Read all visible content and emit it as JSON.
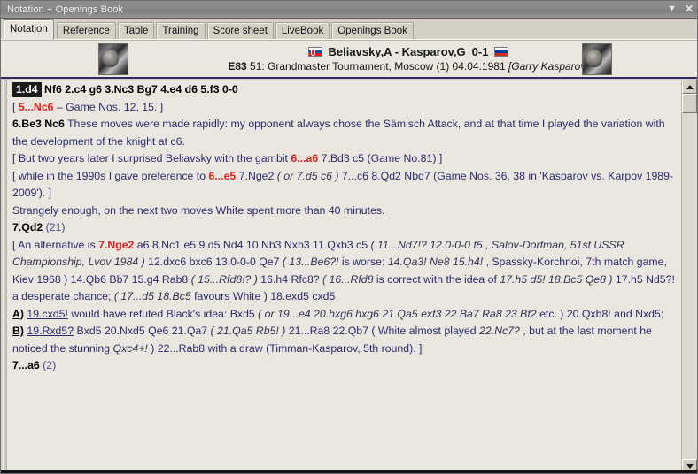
{
  "window": {
    "title": "Notation + Openings Book",
    "minimize_icon": "chevron-down-icon",
    "close_icon": "close-icon",
    "close_glyph": "✕",
    "minimize_glyph": "▼"
  },
  "tabs": [
    {
      "label": "Notation",
      "active": true
    },
    {
      "label": "Reference",
      "active": false
    },
    {
      "label": "Table",
      "active": false
    },
    {
      "label": "Training",
      "active": false
    },
    {
      "label": "Score sheet",
      "active": false
    },
    {
      "label": "LiveBook",
      "active": false
    },
    {
      "label": "Openings Book",
      "active": false
    }
  ],
  "game_header": {
    "white_flag": "slovakia-flag",
    "black_flag": "russia-flag",
    "pairing": "Beliavsky,A - Kasparov,G",
    "result": "0-1",
    "eco": "E83",
    "event": "51: Grandmaster Tournament, Moscow (1) 04.04.1981",
    "annotator": "[Garry Kasparov]",
    "white_photo": "white-player-photo",
    "black_photo": "black-player-photo"
  },
  "notation": {
    "line1": {
      "selected_move": "1.d4",
      "rest": "Nf6  2.c4  g6  3.Nc3  Bg7  4.e4  d6  5.f3  0-0"
    },
    "line2": {
      "open": "[ ",
      "red": "5...Nc6",
      "text": " – Game Nos. 12, 15. ]"
    },
    "line3": {
      "moves": "6.Be3  Nc6",
      "comment": " These moves were made rapidly: my opponent always chose the Sämisch Attack, and at that time I played the variation with the development of the knight at c6."
    },
    "line4": {
      "a": "[ But two years later I surprised Beliavsky with the gambit ",
      "red": "6...a6",
      "b": "  7.Bd3  c5 (Game No.81) ]"
    },
    "line5": {
      "a": "[ while in the 1990s I gave preference to ",
      "red": "6...e5",
      "b": "  7.Nge2  ",
      "ital": "( or 7.d5  c6 )",
      "c": " 7...c6  8.Qd2  Nbd7 (Game Nos. 36, 38 in 'Kasparov vs. Karpov 1989-2009'). ]"
    },
    "line6": "Strangely enough, on the next two moves White spent more than 40 minutes.",
    "line7": {
      "move": "7.Qd2",
      "count": "(21)"
    },
    "line8": {
      "a": "[ An alternative is ",
      "red": "7.Nge2",
      "b": "  a6  8.Nc1  e5  9.d5  Nd4  10.Nb3  Nxb3  11.Qxb3  c5  ",
      "ital1": "( 11...Nd7!?  12.0-0-0  f5 , Salov-Dorfman, 51st USSR Championship, Lvov 1984 )",
      "c": " 12.dxc6  bxc6  13.0-0-0  Qe7  ",
      "ital2": "( 13...Be6?!",
      "d": " is worse: ",
      "ital3": "14.Qa3!  Ne8  15.h4!",
      "e": " , Spassky-Korchnoi, 7th match game, Kiev 1968 )",
      "f": " 14.Qb6  Bb7  15.g4  Rab8  ",
      "ital4": "( 15...Rfd8!? )",
      "g": " 16.h4  Rfc8?  ",
      "ital5": "( 16...Rfd8",
      "h": " is correct with the idea of  ",
      "ital6": "17.h5  d5!  18.Bc5  Qe8 )",
      "i": " 17.h5  Nd5?! a desperate chance; ",
      "ital7": "( 17...d5  18.Bc5",
      "j": " favours White ) 18.exd5  cxd5"
    },
    "line9": {
      "label": "A)",
      "move": "19.cxd5!",
      "a": " would have refuted Black's idea:  Bxd5  ",
      "ital": "( or 19...e4  20.hxg6  hxg6  21.Qa5  exf3  22.Ba7  Ra8  23.Bf2",
      "b": " etc. ) 20.Qxb8! and Nxd5;"
    },
    "line10": {
      "label": "B)",
      "move": "19.Rxd5?",
      "a": " Bxd5  20.Nxd5  Qe6  21.Qa7  ",
      "ital1": "( 21.Qa5  Rb5! )",
      "b": " 21...Ra8  22.Qb7  ",
      "c": "( White almost played ",
      "ital2": "22.Nc7?",
      "d": " , but at the last moment he noticed the stunning  ",
      "ital3": "Qxc4+!",
      "e": " ) 22...Rab8 with a draw (Timman-Kasparov, 5th round). ]"
    },
    "line11": {
      "move": "7...a6",
      "count": "(2)"
    }
  },
  "scrollbar": {
    "up_icon": "arrow-up-icon",
    "down_icon": "arrow-down-icon",
    "thumb": "scroll-thumb"
  }
}
